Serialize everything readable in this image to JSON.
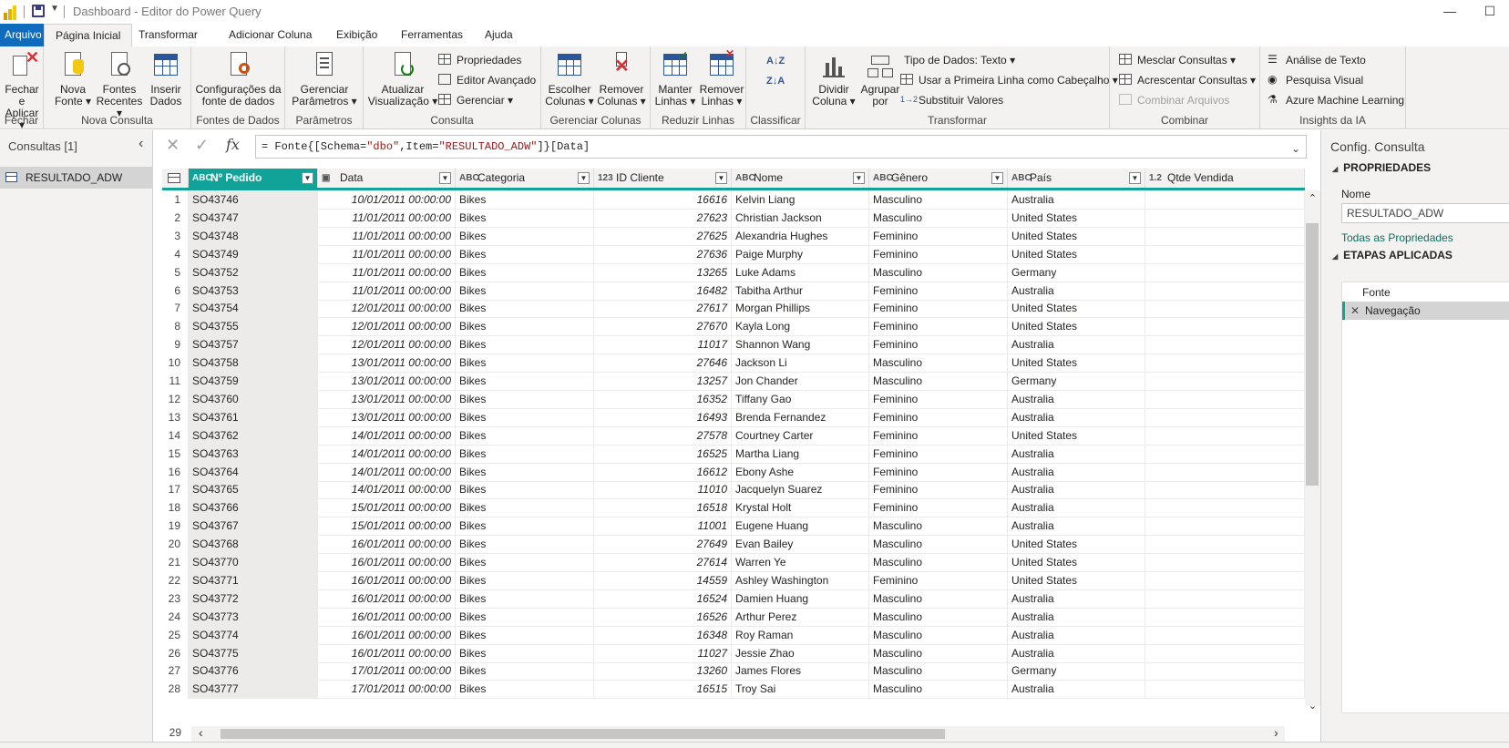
{
  "window": {
    "title": "Dashboard - Editor do Power Query",
    "minimize": "—",
    "maximize": "☐"
  },
  "tabs": [
    "Arquivo",
    "Página Inicial",
    "Transformar",
    "Adicionar Coluna",
    "Exibição",
    "Ferramentas",
    "Ajuda"
  ],
  "ribbon": {
    "fechar": {
      "label": "Fechar",
      "close_apply": [
        "Fechar e",
        "Aplicar ▾"
      ]
    },
    "nova_consulta": {
      "label": "Nova Consulta",
      "nova_fonte": [
        "Nova",
        "Fonte ▾"
      ],
      "fontes_recentes": [
        "Fontes",
        "Recentes ▾"
      ],
      "inserir_dados": [
        "Inserir",
        "Dados"
      ]
    },
    "fontes_dados": {
      "label": "Fontes de Dados",
      "config": [
        "Configurações da",
        "fonte de dados"
      ]
    },
    "parametros": {
      "label": "Parâmetros",
      "gerenciar": [
        "Gerenciar",
        "Parâmetros ▾"
      ]
    },
    "consulta": {
      "label": "Consulta",
      "atualizar": [
        "Atualizar",
        "Visualização ▾"
      ],
      "propriedades": "Propriedades",
      "editor_avancado": "Editor Avançado",
      "gerenciar": "Gerenciar ▾"
    },
    "gerenciar_colunas": {
      "label": "Gerenciar Colunas",
      "escolher": [
        "Escolher",
        "Colunas ▾"
      ],
      "remover": [
        "Remover",
        "Colunas ▾"
      ]
    },
    "reduzir_linhas": {
      "label": "Reduzir Linhas",
      "manter": [
        "Manter",
        "Linhas ▾"
      ],
      "remover": [
        "Remover",
        "Linhas ▾"
      ]
    },
    "classificar": {
      "label": "Classificar",
      "az": "A↓Z",
      "za": "Z↓A"
    },
    "transformar": {
      "label": "Transformar",
      "dividir": [
        "Dividir",
        "Coluna ▾"
      ],
      "agrupar": [
        "Agrupar",
        "por"
      ],
      "tipo_dados": "Tipo de Dados: Texto ▾",
      "primeira_linha": "Usar a Primeira Linha como Cabeçalho ▾",
      "substituir": "Substituir Valores"
    },
    "combinar": {
      "label": "Combinar",
      "mesclar": "Mesclar Consultas ▾",
      "acrescentar": "Acrescentar Consultas ▾",
      "combinar_arquivos": "Combinar Arquivos"
    },
    "insights": {
      "label": "Insights da IA",
      "analise_texto": "Análise de Texto",
      "pesquisa_visual": "Pesquisa Visual",
      "azure_ml": "Azure Machine Learning"
    }
  },
  "left_panel": {
    "title": "Consultas [1]",
    "collapse": "‹",
    "query": "RESULTADO_ADW"
  },
  "formula": {
    "prefix": "= Fonte{[Schema=",
    "schema": "\"dbo\"",
    "mid": ",Item=",
    "item": "\"RESULTADO_ADW\"",
    "suffix": "]}[Data]",
    "cancel": "✕",
    "accept": "✓",
    "fx": "fx",
    "expand": "⌄"
  },
  "columns": [
    {
      "type": "ABC",
      "name": "Nº Pedido"
    },
    {
      "type": "▣",
      "name": "Data"
    },
    {
      "type": "ABC",
      "name": "Categoria"
    },
    {
      "type": "123",
      "name": "ID Cliente"
    },
    {
      "type": "ABC",
      "name": "Nome"
    },
    {
      "type": "ABC",
      "name": "Gênero"
    },
    {
      "type": "ABC",
      "name": "País"
    },
    {
      "type": "1.2",
      "name": "Qtde Vendida"
    }
  ],
  "rows": [
    [
      "1",
      "SO43746",
      "10/01/2011 00:00:00",
      "Bikes",
      "16616",
      "Kelvin Liang",
      "Masculino",
      "Australia"
    ],
    [
      "2",
      "SO43747",
      "11/01/2011 00:00:00",
      "Bikes",
      "27623",
      "Christian Jackson",
      "Masculino",
      "United States"
    ],
    [
      "3",
      "SO43748",
      "11/01/2011 00:00:00",
      "Bikes",
      "27625",
      "Alexandria Hughes",
      "Feminino",
      "United States"
    ],
    [
      "4",
      "SO43749",
      "11/01/2011 00:00:00",
      "Bikes",
      "27636",
      "Paige Murphy",
      "Feminino",
      "United States"
    ],
    [
      "5",
      "SO43752",
      "11/01/2011 00:00:00",
      "Bikes",
      "13265",
      "Luke Adams",
      "Masculino",
      "Germany"
    ],
    [
      "6",
      "SO43753",
      "11/01/2011 00:00:00",
      "Bikes",
      "16482",
      "Tabitha Arthur",
      "Feminino",
      "Australia"
    ],
    [
      "7",
      "SO43754",
      "12/01/2011 00:00:00",
      "Bikes",
      "27617",
      "Morgan Phillips",
      "Feminino",
      "United States"
    ],
    [
      "8",
      "SO43755",
      "12/01/2011 00:00:00",
      "Bikes",
      "27670",
      "Kayla Long",
      "Feminino",
      "United States"
    ],
    [
      "9",
      "SO43757",
      "12/01/2011 00:00:00",
      "Bikes",
      "11017",
      "Shannon Wang",
      "Feminino",
      "Australia"
    ],
    [
      "10",
      "SO43758",
      "13/01/2011 00:00:00",
      "Bikes",
      "27646",
      "Jackson Li",
      "Masculino",
      "United States"
    ],
    [
      "11",
      "SO43759",
      "13/01/2011 00:00:00",
      "Bikes",
      "13257",
      "Jon Chander",
      "Masculino",
      "Germany"
    ],
    [
      "12",
      "SO43760",
      "13/01/2011 00:00:00",
      "Bikes",
      "16352",
      "Tiffany Gao",
      "Feminino",
      "Australia"
    ],
    [
      "13",
      "SO43761",
      "13/01/2011 00:00:00",
      "Bikes",
      "16493",
      "Brenda Fernandez",
      "Feminino",
      "Australia"
    ],
    [
      "14",
      "SO43762",
      "14/01/2011 00:00:00",
      "Bikes",
      "27578",
      "Courtney Carter",
      "Feminino",
      "United States"
    ],
    [
      "15",
      "SO43763",
      "14/01/2011 00:00:00",
      "Bikes",
      "16525",
      "Martha Liang",
      "Feminino",
      "Australia"
    ],
    [
      "16",
      "SO43764",
      "14/01/2011 00:00:00",
      "Bikes",
      "16612",
      "Ebony Ashe",
      "Feminino",
      "Australia"
    ],
    [
      "17",
      "SO43765",
      "14/01/2011 00:00:00",
      "Bikes",
      "11010",
      "Jacquelyn Suarez",
      "Feminino",
      "Australia"
    ],
    [
      "18",
      "SO43766",
      "15/01/2011 00:00:00",
      "Bikes",
      "16518",
      "Krystal Holt",
      "Feminino",
      "Australia"
    ],
    [
      "19",
      "SO43767",
      "15/01/2011 00:00:00",
      "Bikes",
      "11001",
      "Eugene Huang",
      "Masculino",
      "Australia"
    ],
    [
      "20",
      "SO43768",
      "16/01/2011 00:00:00",
      "Bikes",
      "27649",
      "Evan Bailey",
      "Masculino",
      "United States"
    ],
    [
      "21",
      "SO43770",
      "16/01/2011 00:00:00",
      "Bikes",
      "27614",
      "Warren Ye",
      "Masculino",
      "United States"
    ],
    [
      "22",
      "SO43771",
      "16/01/2011 00:00:00",
      "Bikes",
      "14559",
      "Ashley Washington",
      "Feminino",
      "United States"
    ],
    [
      "23",
      "SO43772",
      "16/01/2011 00:00:00",
      "Bikes",
      "16524",
      "Damien Huang",
      "Masculino",
      "Australia"
    ],
    [
      "24",
      "SO43773",
      "16/01/2011 00:00:00",
      "Bikes",
      "16526",
      "Arthur Perez",
      "Masculino",
      "Australia"
    ],
    [
      "25",
      "SO43774",
      "16/01/2011 00:00:00",
      "Bikes",
      "16348",
      "Roy Raman",
      "Masculino",
      "Australia"
    ],
    [
      "26",
      "SO43775",
      "16/01/2011 00:00:00",
      "Bikes",
      "11027",
      "Jessie Zhao",
      "Masculino",
      "Australia"
    ],
    [
      "27",
      "SO43776",
      "17/01/2011 00:00:00",
      "Bikes",
      "13260",
      "James Flores",
      "Masculino",
      "Germany"
    ],
    [
      "28",
      "SO43777",
      "17/01/2011 00:00:00",
      "Bikes",
      "16515",
      "Troy Sai",
      "Masculino",
      "Australia"
    ]
  ],
  "partial_row": "29",
  "right_panel": {
    "title": "Config. Consulta",
    "properties": "PROPRIEDADES",
    "name_label": "Nome",
    "name_value": "RESULTADO_ADW",
    "all_props": "Todas as Propriedades",
    "steps_title": "ETAPAS APLICADAS",
    "steps": [
      "Fonte",
      "Navegação"
    ],
    "delete_icon": "✕"
  },
  "scroll": {
    "up": "⌃",
    "down": "⌄",
    "left": "‹",
    "right": "›"
  }
}
